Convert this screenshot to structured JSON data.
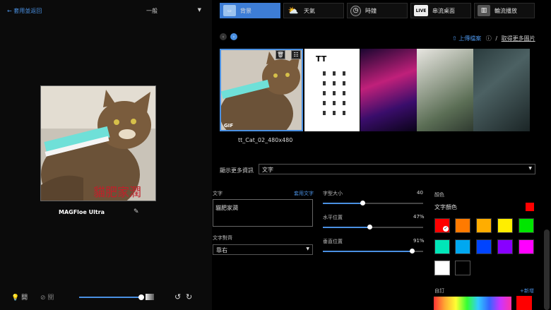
{
  "left": {
    "back": "套用並返回",
    "mode": "一般",
    "device_name": "MAGFloe Ultra",
    "preview_overlay_text": "貓肥家潤",
    "light_label": "開",
    "light_off_label": "關"
  },
  "tabs": [
    {
      "label": "背景",
      "icon": "background-icon"
    },
    {
      "label": "天氣",
      "icon": "weather-icon"
    },
    {
      "label": "時鐘",
      "icon": "clock-icon"
    },
    {
      "label": "串流桌面",
      "icon": "live-icon",
      "icon_text": "LIVE"
    },
    {
      "label": "輪流播放",
      "icon": "slideshow-icon"
    }
  ],
  "gallery": {
    "upload": "上傳檔案",
    "more": "取得更多圖片",
    "gif_tag": "GIF",
    "selected_file": "tt_Cat_02_480x480",
    "panel_logo": "TT"
  },
  "info": {
    "label": "顯示更多資訊",
    "value": "文字"
  },
  "text": {
    "label": "文字",
    "apply": "套用文字",
    "value": "貓肥家潤",
    "align_label": "文字對齊",
    "align_value": "靠右"
  },
  "ranges": [
    {
      "label": "字型大小",
      "value": "40",
      "fraction": 0.4
    },
    {
      "label": "水平位置",
      "value": "47%",
      "fraction": 0.47
    },
    {
      "label": "垂直位置",
      "value": "91%",
      "fraction": 0.91
    }
  ],
  "color": {
    "label": "顏色",
    "text_color_label": "文字顏色",
    "current": "#ff0000",
    "swatches": [
      "#ff0000",
      "#ff7a00",
      "#ffad00",
      "#ffee00",
      "#00e600",
      "#00e6b8",
      "#00a8f0",
      "#0044ff",
      "#8800ff",
      "#ff00ff",
      "#ffffff",
      "#000000"
    ],
    "custom_label": "自訂",
    "add": "新增"
  }
}
